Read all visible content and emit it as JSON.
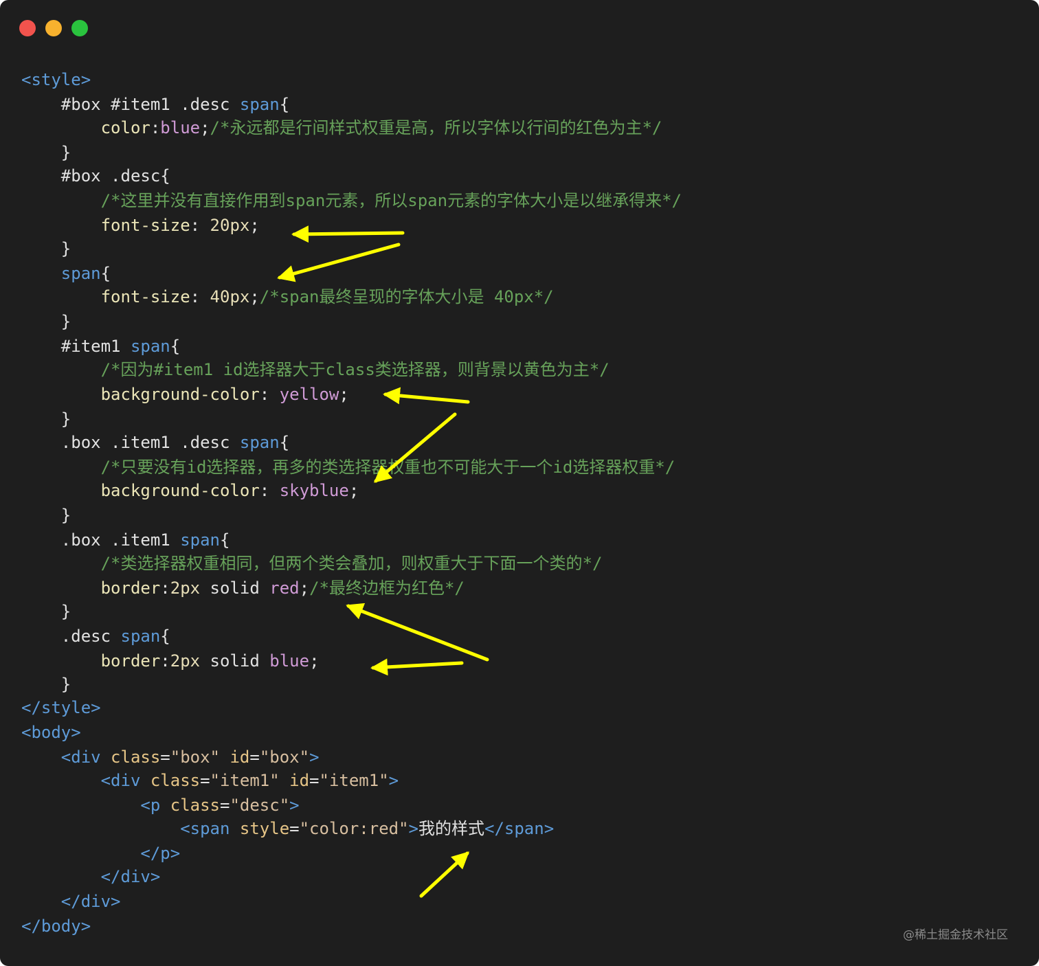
{
  "window": {
    "controls": [
      {
        "name": "close",
        "color": "#f2534d"
      },
      {
        "name": "minimize",
        "color": "#f7b12e"
      },
      {
        "name": "maximize",
        "color": "#2ac33e"
      }
    ]
  },
  "code": {
    "lines": [
      [
        {
          "t": "<style>",
          "c": "tag"
        }
      ],
      [
        {
          "t": "    #box #item1 .desc ",
          "c": "sel"
        },
        {
          "t": "span",
          "c": "tag"
        },
        {
          "t": "{",
          "c": "plain"
        }
      ],
      [
        {
          "t": "        color",
          "c": "prop"
        },
        {
          "t": ":",
          "c": "plain"
        },
        {
          "t": "blue",
          "c": "val"
        },
        {
          "t": ";",
          "c": "plain"
        },
        {
          "t": "/*永远都是行间样式权重是高，所以字体以行间的红色为主*/",
          "c": "comment"
        }
      ],
      [
        {
          "t": "    }",
          "c": "plain"
        }
      ],
      [
        {
          "t": "    #box .desc",
          "c": "sel"
        },
        {
          "t": "{",
          "c": "plain"
        }
      ],
      [
        {
          "t": "        /*这里并没有直接作用到span元素，所以span元素的字体大小是以继承得来*/",
          "c": "comment"
        }
      ],
      [
        {
          "t": "        font-size",
          "c": "prop"
        },
        {
          "t": ": ",
          "c": "plain"
        },
        {
          "t": "20px",
          "c": "num"
        },
        {
          "t": ";",
          "c": "plain"
        }
      ],
      [
        {
          "t": "    }",
          "c": "plain"
        }
      ],
      [
        {
          "t": "    ",
          "c": "plain"
        },
        {
          "t": "span",
          "c": "tag"
        },
        {
          "t": "{",
          "c": "plain"
        }
      ],
      [
        {
          "t": "        font-size",
          "c": "prop"
        },
        {
          "t": ": ",
          "c": "plain"
        },
        {
          "t": "40px",
          "c": "num"
        },
        {
          "t": ";",
          "c": "plain"
        },
        {
          "t": "/*span最终呈现的字体大小是 40px*/",
          "c": "comment"
        }
      ],
      [
        {
          "t": "    }",
          "c": "plain"
        }
      ],
      [
        {
          "t": "    #item1 ",
          "c": "sel"
        },
        {
          "t": "span",
          "c": "tag"
        },
        {
          "t": "{",
          "c": "plain"
        }
      ],
      [
        {
          "t": "        /*因为#item1 id选择器大于class类选择器，则背景以黄色为主*/",
          "c": "comment"
        }
      ],
      [
        {
          "t": "        background-color",
          "c": "prop"
        },
        {
          "t": ": ",
          "c": "plain"
        },
        {
          "t": "yellow",
          "c": "val"
        },
        {
          "t": ";",
          "c": "plain"
        }
      ],
      [
        {
          "t": "    }",
          "c": "plain"
        }
      ],
      [
        {
          "t": "    .box .item1 .desc ",
          "c": "sel"
        },
        {
          "t": "span",
          "c": "tag"
        },
        {
          "t": "{",
          "c": "plain"
        }
      ],
      [
        {
          "t": "        /*只要没有id选择器，再多的类选择器权重也不可能大于一个id选择器权重*/",
          "c": "comment"
        }
      ],
      [
        {
          "t": "        background-color",
          "c": "prop"
        },
        {
          "t": ": ",
          "c": "plain"
        },
        {
          "t": "skyblue",
          "c": "val"
        },
        {
          "t": ";",
          "c": "plain"
        }
      ],
      [
        {
          "t": "    }",
          "c": "plain"
        }
      ],
      [
        {
          "t": "    .box .item1 ",
          "c": "sel"
        },
        {
          "t": "span",
          "c": "tag"
        },
        {
          "t": "{",
          "c": "plain"
        }
      ],
      [
        {
          "t": "        /*类选择器权重相同，但两个类会叠加，则权重大于下面一个类的*/",
          "c": "comment"
        }
      ],
      [
        {
          "t": "        border",
          "c": "prop"
        },
        {
          "t": ":",
          "c": "plain"
        },
        {
          "t": "2px",
          "c": "num"
        },
        {
          "t": " solid ",
          "c": "plain"
        },
        {
          "t": "red",
          "c": "val"
        },
        {
          "t": ";",
          "c": "plain"
        },
        {
          "t": "/*最终边框为红色*/",
          "c": "comment"
        }
      ],
      [
        {
          "t": "    }",
          "c": "plain"
        }
      ],
      [
        {
          "t": "    .desc ",
          "c": "sel"
        },
        {
          "t": "span",
          "c": "tag"
        },
        {
          "t": "{",
          "c": "plain"
        }
      ],
      [
        {
          "t": "        border",
          "c": "prop"
        },
        {
          "t": ":",
          "c": "plain"
        },
        {
          "t": "2px",
          "c": "num"
        },
        {
          "t": " solid ",
          "c": "plain"
        },
        {
          "t": "blue",
          "c": "val"
        },
        {
          "t": ";",
          "c": "plain"
        }
      ],
      [
        {
          "t": "    }",
          "c": "plain"
        }
      ],
      [
        {
          "t": "</style>",
          "c": "tag"
        }
      ],
      [
        {
          "t": "<body>",
          "c": "tag"
        }
      ],
      [
        {
          "t": "    <div ",
          "c": "tag"
        },
        {
          "t": "class",
          "c": "attr"
        },
        {
          "t": "=",
          "c": "plain"
        },
        {
          "t": "\"box\" ",
          "c": "str"
        },
        {
          "t": "id",
          "c": "attr"
        },
        {
          "t": "=",
          "c": "plain"
        },
        {
          "t": "\"box\"",
          "c": "str"
        },
        {
          "t": ">",
          "c": "tag"
        }
      ],
      [
        {
          "t": "        <div ",
          "c": "tag"
        },
        {
          "t": "class",
          "c": "attr"
        },
        {
          "t": "=",
          "c": "plain"
        },
        {
          "t": "\"item1\" ",
          "c": "str"
        },
        {
          "t": "id",
          "c": "attr"
        },
        {
          "t": "=",
          "c": "plain"
        },
        {
          "t": "\"item1\"",
          "c": "str"
        },
        {
          "t": ">",
          "c": "tag"
        }
      ],
      [
        {
          "t": "            <p ",
          "c": "tag"
        },
        {
          "t": "class",
          "c": "attr"
        },
        {
          "t": "=",
          "c": "plain"
        },
        {
          "t": "\"desc\"",
          "c": "str"
        },
        {
          "t": ">",
          "c": "tag"
        }
      ],
      [
        {
          "t": "                <span ",
          "c": "tag"
        },
        {
          "t": "style",
          "c": "attr"
        },
        {
          "t": "=",
          "c": "plain"
        },
        {
          "t": "\"color:red\"",
          "c": "str"
        },
        {
          "t": ">",
          "c": "tag"
        },
        {
          "t": "我的样式",
          "c": "plain"
        },
        {
          "t": "</span>",
          "c": "tag"
        }
      ],
      [
        {
          "t": "            </p>",
          "c": "tag"
        }
      ],
      [
        {
          "t": "        </div>",
          "c": "tag"
        }
      ],
      [
        {
          "t": "    </div>",
          "c": "tag"
        }
      ],
      [
        {
          "t": "</body>",
          "c": "tag"
        }
      ]
    ]
  },
  "annotation_color": "#ffff00",
  "watermark": "@稀土掘金技术社区"
}
